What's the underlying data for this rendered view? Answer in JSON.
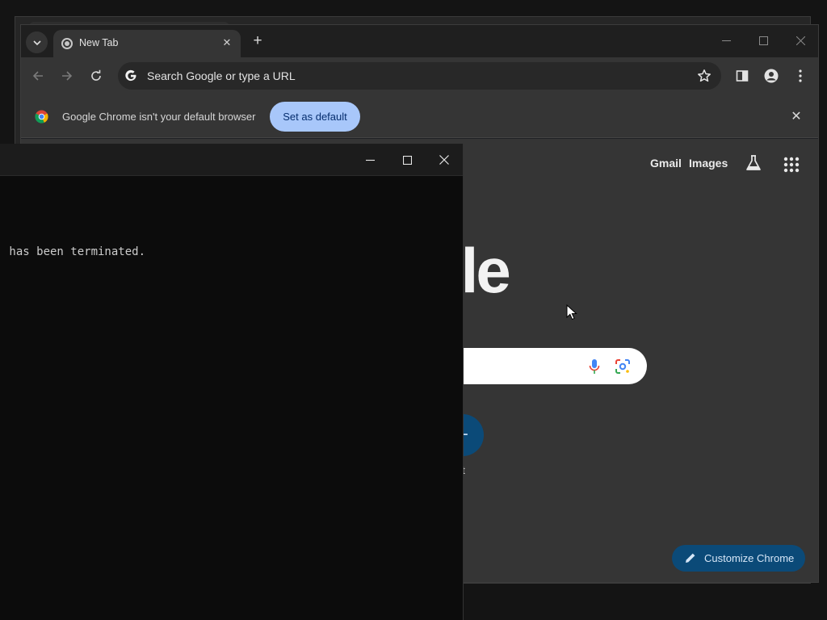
{
  "chrome": {
    "tab_title": "New Tab",
    "omnibox_placeholder": "Search Google or type a URL",
    "infobar": {
      "message": "Google Chrome isn't your default browser",
      "button_label": "Set as default"
    },
    "header_links": {
      "gmail": "Gmail",
      "images": "Images"
    },
    "logo_visible": "gle",
    "shortcut_label": "hortcut",
    "shortcut_symbol": "+",
    "customize_label": "Customize Chrome",
    "colors": {
      "accent_button": "#a8c7fa",
      "customize_bg": "#0b4a78",
      "page_bg": "#353535"
    }
  },
  "terminal": {
    "output_line": " has been terminated."
  },
  "icons": [
    "tab-search-icon",
    "chrome-favicon-icon",
    "close-icon",
    "plus-icon",
    "minimize-icon",
    "maximize-icon",
    "back-icon",
    "forward-icon",
    "reload-icon",
    "google-g-icon",
    "star-icon",
    "side-panel-icon",
    "profile-icon",
    "more-icon",
    "chrome-logo-icon",
    "labs-flask-icon",
    "apps-grid-icon",
    "mic-icon",
    "lens-icon",
    "pencil-icon",
    "mouse-cursor-icon"
  ]
}
